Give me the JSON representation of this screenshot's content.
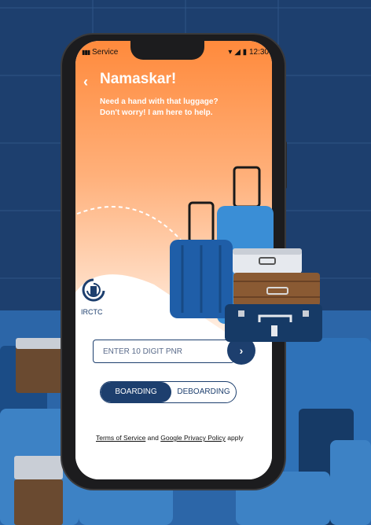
{
  "status_bar": {
    "carrier": "Service",
    "time": "12:30"
  },
  "header": {
    "title": "Namaskar!",
    "subtitle_line1": "Need a hand with that luggage?",
    "subtitle_line2": "Don't worry! I am here to help."
  },
  "brand": {
    "name": "IRCTC"
  },
  "form": {
    "pnr_placeholder": "ENTER 10 DIGIT PNR",
    "submit_glyph": "›"
  },
  "mode_toggle": {
    "options": [
      "BOARDING",
      "DEBOARDING"
    ],
    "selected": "BOARDING"
  },
  "footer": {
    "terms_label": "Terms of Service",
    "connector": "and",
    "privacy_label": "Google Privacy Policy",
    "suffix": "apply"
  },
  "colors": {
    "navy": "#1d3f6e",
    "orange": "#ff8a3c",
    "background": "#1d3f6e"
  }
}
